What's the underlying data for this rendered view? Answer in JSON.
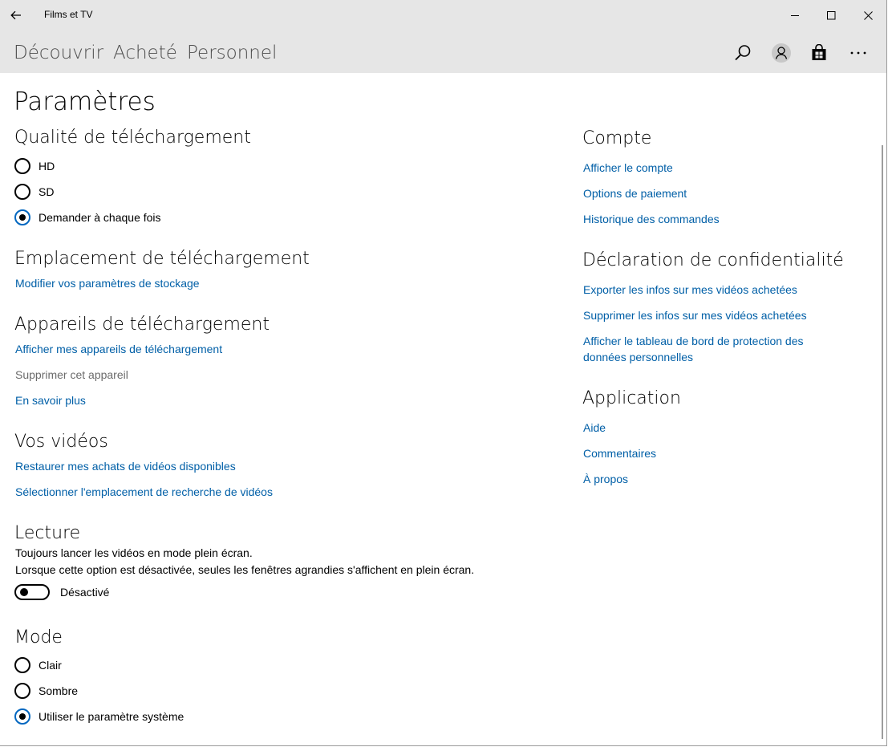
{
  "window": {
    "title": "Films et TV"
  },
  "nav": {
    "tabs": [
      "Découvrir",
      "Acheté",
      "Personnel"
    ]
  },
  "page": {
    "title": "Paramètres"
  },
  "quality": {
    "heading": "Qualité de téléchargement",
    "options": [
      "HD",
      "SD",
      "Demander à chaque fois"
    ],
    "selected": "Demander à chaque fois"
  },
  "location": {
    "heading": "Emplacement de téléchargement",
    "link": "Modifier vos paramètres de stockage"
  },
  "devices": {
    "heading": "Appareils de téléchargement",
    "show_link": "Afficher mes appareils de téléchargement",
    "remove_disabled": "Supprimer cet appareil",
    "learn_more": "En savoir plus"
  },
  "videos": {
    "heading": "Vos vidéos",
    "restore_link": "Restaurer mes achats de vidéos disponibles",
    "select_link": "Sélectionner l'emplacement de recherche de vidéos"
  },
  "playback": {
    "heading": "Lecture",
    "line1": "Toujours lancer les vidéos en mode plein écran.",
    "line2": "Lorsque cette option est désactivée, seules les fenêtres agrandies s'affichent en plein écran.",
    "toggle_state": "Désactivé"
  },
  "mode": {
    "heading": "Mode",
    "options": [
      "Clair",
      "Sombre",
      "Utiliser le paramètre système"
    ],
    "selected": "Utiliser le paramètre système"
  },
  "account": {
    "heading": "Compte",
    "links": [
      "Afficher le compte",
      "Options de paiement",
      "Historique des commandes"
    ]
  },
  "privacy": {
    "heading": "Déclaration de confidentialité",
    "links": [
      "Exporter les infos sur mes vidéos achetées",
      "Supprimer les infos sur mes vidéos achetées"
    ],
    "dashboard_line1": "Afficher le tableau de bord de protection des",
    "dashboard_line2": "données personnelles"
  },
  "application": {
    "heading": "Application",
    "links": [
      "Aide",
      "Commentaires",
      "À propos"
    ]
  },
  "colors": {
    "accent": "#0067c0",
    "link": "#005fa7",
    "chrome": "#e6e6e6"
  }
}
